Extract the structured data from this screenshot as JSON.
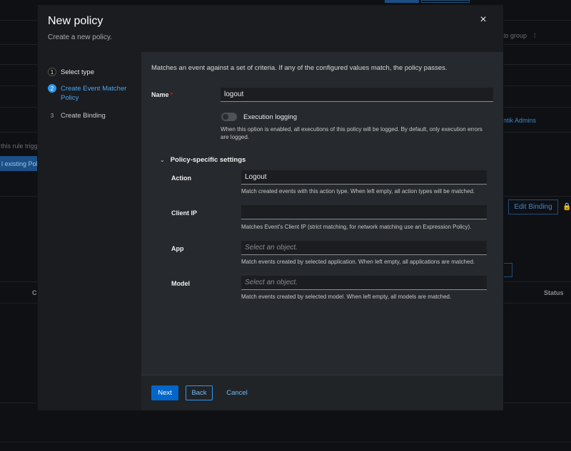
{
  "background": {
    "col_to_group": "to group",
    "rule_trigger": "this rule trigg",
    "existing_policy": "l existing Pol",
    "authentik_admins": "ntik Admins",
    "edit_binding": "Edit Binding",
    "col_c": "C",
    "col_status": "Status"
  },
  "modal": {
    "title": "New policy",
    "subtitle": "Create a new policy.",
    "close_icon": "×",
    "steps": [
      {
        "num": "1",
        "label": "Select type"
      },
      {
        "num": "2",
        "label": "Create Event Matcher Policy"
      },
      {
        "num": "3",
        "label": "Create Binding"
      }
    ],
    "description": "Matches an event against a set of criteria. If any of the configured values match, the policy passes.",
    "name": {
      "label": "Name",
      "required_mark": "*",
      "value": "logout"
    },
    "execution_logging": {
      "label": "Execution logging",
      "enabled": false,
      "helper_line1": "When this option is enabled, all executions of this policy will be logged. By default, only execution errors",
      "helper_line2": "are logged."
    },
    "section": {
      "chevron": "⌄",
      "title": "Policy-specific settings"
    },
    "fields": {
      "action": {
        "label": "Action",
        "value": "Logout",
        "helper": "Match created events with this action type. When left empty, all action types will be matched."
      },
      "client_ip": {
        "label": "Client IP",
        "value": "",
        "helper": "Matches Event's Client IP (strict matching, for network matching use an Expression Policy)."
      },
      "app": {
        "label": "App",
        "placeholder": "Select an object.",
        "helper": "Match events created by selected application. When left empty, all applications are matched."
      },
      "model": {
        "label": "Model",
        "placeholder": "Select an object.",
        "helper": "Match events created by selected model. When left empty, all models are matched."
      }
    },
    "footer": {
      "next": "Next",
      "back": "Back",
      "cancel": "Cancel"
    }
  }
}
